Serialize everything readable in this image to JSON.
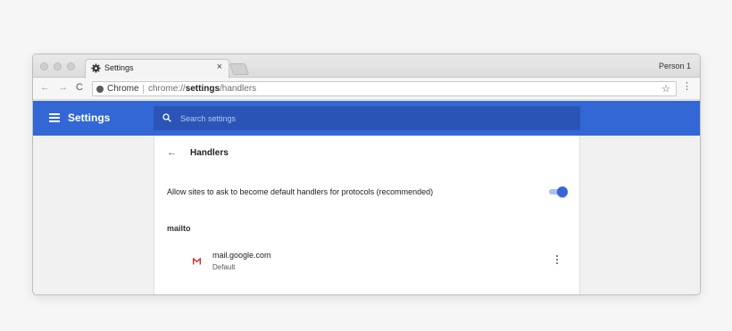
{
  "tab": {
    "title": "Settings",
    "close_label": "×"
  },
  "profile": "Person 1",
  "toolbar": {
    "back": "←",
    "forward": "→",
    "reload": "C"
  },
  "omnibox": {
    "scheme_label": "Chrome",
    "url_prefix": "chrome://",
    "url_bold": "settings",
    "url_suffix": "/handlers",
    "star": "☆",
    "menu": "⋮"
  },
  "header": {
    "title": "Settings",
    "search_placeholder": "Search settings"
  },
  "page": {
    "back_arrow": "←",
    "title": "Handlers",
    "allow_text": "Allow sites to ask to become default handlers for protocols (recommended)",
    "allow_enabled": true,
    "section": "mailto",
    "handler": {
      "name": "mail.google.com",
      "status": "Default",
      "icon": "gmail-icon"
    }
  },
  "colors": {
    "accent": "#3367d6",
    "search_bg": "#2a55b6",
    "toggle_track": "#a7c0f1",
    "gmail_red": "#d93025"
  }
}
